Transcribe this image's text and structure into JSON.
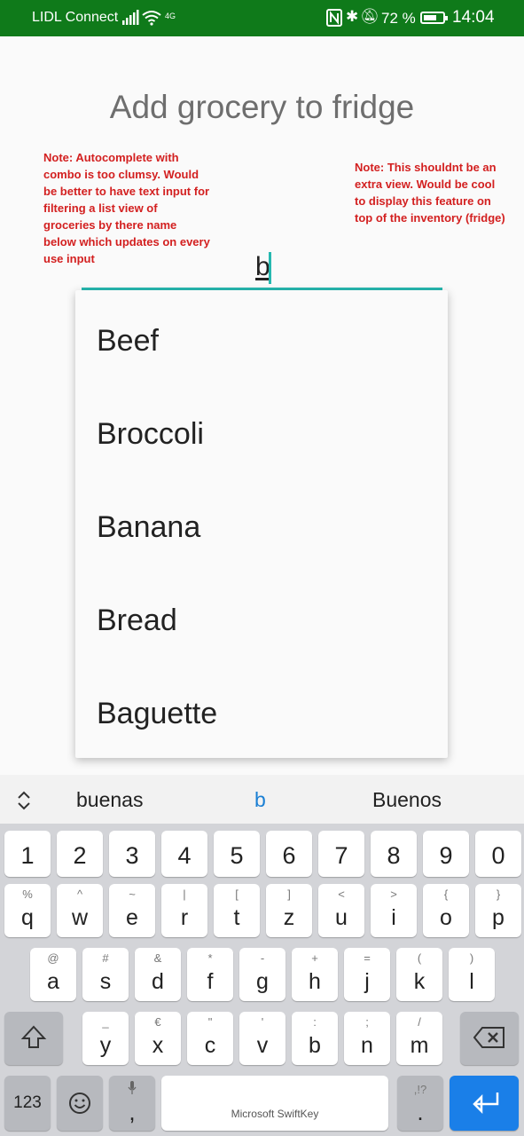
{
  "status_bar": {
    "carrier": "LIDL Connect",
    "misc": "4G",
    "battery_percent": "72 %",
    "battery_level": 0.72,
    "time": "14:04"
  },
  "title": "Add grocery to fridge",
  "notes": {
    "left": "Note: Autocomplete with combo is too clumsy. Would be better to have text input for filtering a list view of groceries by there name below which updates on every use input",
    "right": "Note: This shouldnt be an extra view. Would be cool to display this feature on top of the inventory (fridge)"
  },
  "search": {
    "value": "b"
  },
  "dropdown": {
    "options": [
      "Beef",
      "Broccoli",
      "Banana",
      "Bread",
      "Baguette"
    ]
  },
  "keyboard": {
    "suggestions": [
      "buenas",
      "b",
      "Buenos"
    ],
    "numbers": [
      "1",
      "2",
      "3",
      "4",
      "5",
      "6",
      "7",
      "8",
      "9",
      "0"
    ],
    "row2": [
      {
        "main": "q",
        "sec": "%"
      },
      {
        "main": "w",
        "sec": "^"
      },
      {
        "main": "e",
        "sec": "~"
      },
      {
        "main": "r",
        "sec": "|"
      },
      {
        "main": "t",
        "sec": "["
      },
      {
        "main": "z",
        "sec": "]"
      },
      {
        "main": "u",
        "sec": "<"
      },
      {
        "main": "i",
        "sec": ">"
      },
      {
        "main": "o",
        "sec": "{"
      },
      {
        "main": "p",
        "sec": "}"
      }
    ],
    "row3": [
      {
        "main": "a",
        "sec": "@"
      },
      {
        "main": "s",
        "sec": "#"
      },
      {
        "main": "d",
        "sec": "&"
      },
      {
        "main": "f",
        "sec": "*"
      },
      {
        "main": "g",
        "sec": "-"
      },
      {
        "main": "h",
        "sec": "+"
      },
      {
        "main": "j",
        "sec": "="
      },
      {
        "main": "k",
        "sec": "("
      },
      {
        "main": "l",
        "sec": ")"
      }
    ],
    "row4": [
      {
        "main": "y",
        "sec": "_"
      },
      {
        "main": "x",
        "sec": "€"
      },
      {
        "main": "c",
        "sec": "\""
      },
      {
        "main": "v",
        "sec": "'"
      },
      {
        "main": "b",
        "sec": ":"
      },
      {
        "main": "n",
        "sec": ";"
      },
      {
        "main": "m",
        "sec": "/"
      }
    ],
    "num_key": "123",
    "comma_key": ",",
    "period_key": ".",
    "period_sec": ",!?",
    "space_label": "Microsoft SwiftKey"
  }
}
